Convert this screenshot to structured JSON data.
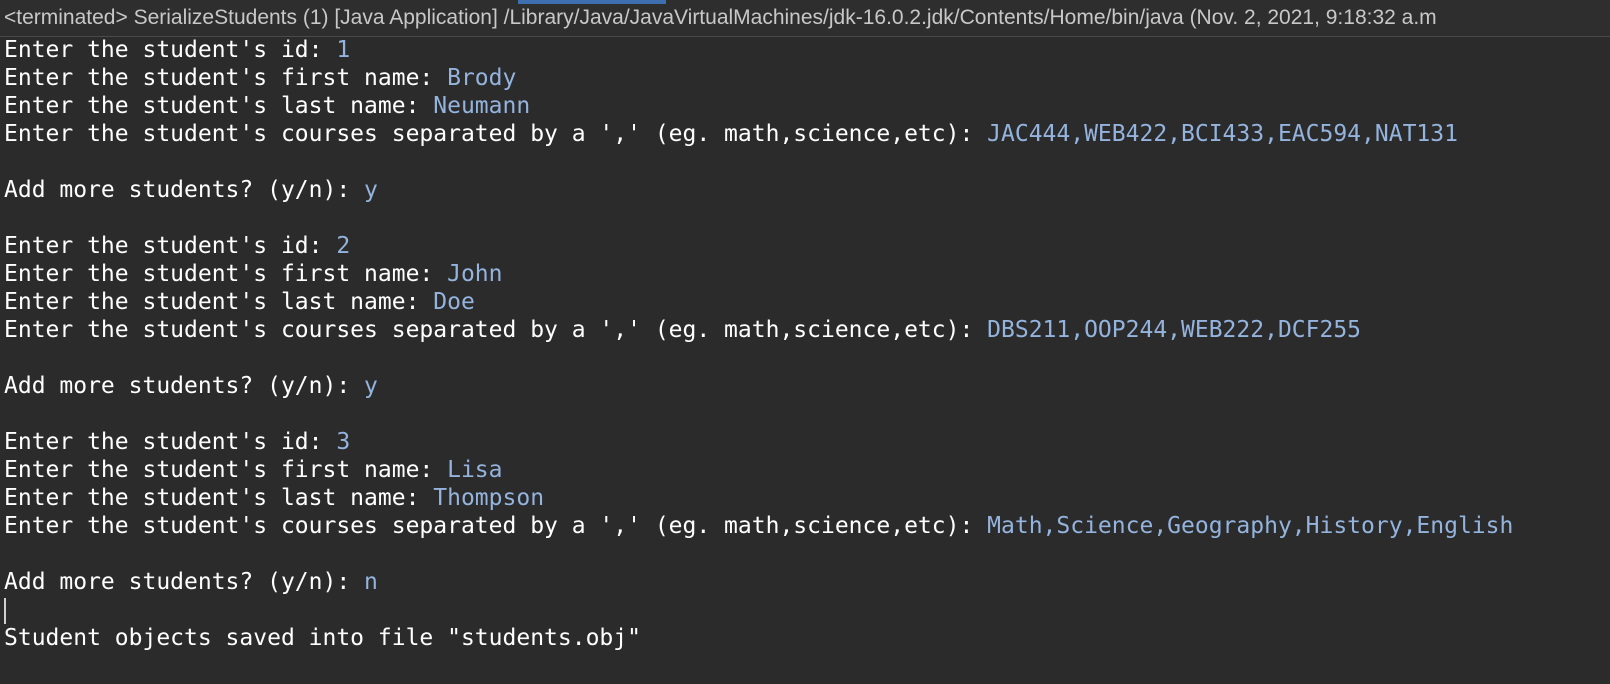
{
  "header": {
    "title": "<terminated> SerializeStudents (1) [Java Application] /Library/Java/JavaVirtualMachines/jdk-16.0.2.jdk/Contents/Home/bin/java  (Nov. 2, 2021, 9:18:32 a.m"
  },
  "colors": {
    "background": "#2b2b2b",
    "prompt_text": "#ffffff",
    "user_input": "#94b4de",
    "header_text": "#c8c8c8"
  },
  "console": {
    "students": [
      {
        "id_prompt": "Enter the student's id: ",
        "id": "1",
        "first_prompt": "Enter the student's first name: ",
        "first": "Brody",
        "last_prompt": "Enter the student's last name: ",
        "last": "Neumann",
        "courses_prompt": "Enter the student's courses separated by a ',' (eg. math,science,etc): ",
        "courses": "JAC444,WEB422,BCI433,EAC594,NAT131",
        "more_prompt": "Add more students? (y/n): ",
        "more": "y"
      },
      {
        "id_prompt": "Enter the student's id: ",
        "id": "2",
        "first_prompt": "Enter the student's first name: ",
        "first": "John",
        "last_prompt": "Enter the student's last name: ",
        "last": "Doe",
        "courses_prompt": "Enter the student's courses separated by a ',' (eg. math,science,etc): ",
        "courses": "DBS211,OOP244,WEB222,DCF255",
        "more_prompt": "Add more students? (y/n): ",
        "more": "y"
      },
      {
        "id_prompt": "Enter the student's id: ",
        "id": "3",
        "first_prompt": "Enter the student's first name: ",
        "first": "Lisa",
        "last_prompt": "Enter the student's last name: ",
        "last": "Thompson",
        "courses_prompt": "Enter the student's courses separated by a ',' (eg. math,science,etc): ",
        "courses": "Math,Science,Geography,History,English",
        "more_prompt": "Add more students? (y/n): ",
        "more": "n"
      }
    ],
    "final_message": "Student objects saved into file \"students.obj\""
  }
}
